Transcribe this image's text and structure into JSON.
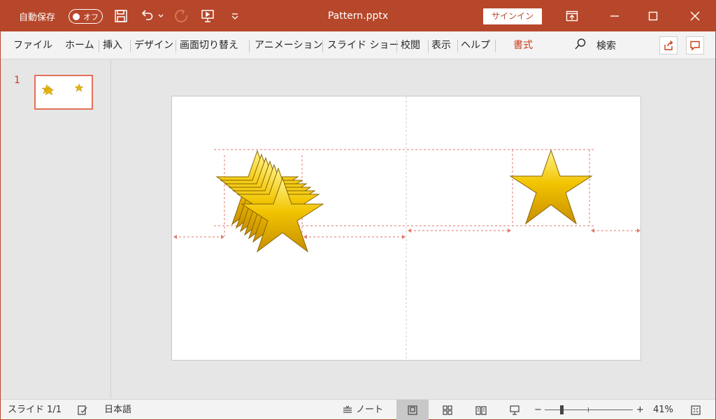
{
  "titlebar": {
    "autosave_label": "自動保存",
    "autosave_state": "オフ",
    "document_title": "Pattern.pptx",
    "signin_label": "サインイン",
    "accent_color": "#b7472a"
  },
  "ribbon": {
    "tabs": [
      {
        "label": "ファイル"
      },
      {
        "label": "ホーム"
      },
      {
        "label": "挿入"
      },
      {
        "label": "デザイン"
      },
      {
        "label": "画面切り替え"
      },
      {
        "label": "アニメーション"
      },
      {
        "label": "スライド ショー"
      },
      {
        "label": "校閲"
      },
      {
        "label": "表示"
      },
      {
        "label": "ヘルプ"
      },
      {
        "label": "書式"
      }
    ],
    "search_label": "検索",
    "active_contextual_color": "#c43e1c"
  },
  "thumbnails": {
    "items": [
      {
        "number": "1"
      }
    ]
  },
  "statusbar": {
    "slide_indicator": "スライド 1/1",
    "language": "日本語",
    "notes_label": "ノート",
    "zoom_minus": "−",
    "zoom_plus": "+",
    "zoom_level": "41%"
  },
  "icons": {
    "save": "save-icon",
    "undo": "undo-icon",
    "redo": "redo-icon",
    "present": "present-icon",
    "customize": "customize-toolbar-icon",
    "ribbon_display": "ribbon-display-icon",
    "minimize": "minimize-icon",
    "maximize": "maximize-icon",
    "close": "close-icon",
    "search": "search-icon",
    "share": "share-icon",
    "comments": "comment-icon",
    "accessibility": "accessibility-check-icon",
    "notes": "notes-icon",
    "view_normal": "normal-view-icon",
    "view_sorter": "slide-sorter-icon",
    "view_reading": "reading-view-icon",
    "view_slideshow": "slideshow-view-icon",
    "fit": "fit-to-window-icon"
  }
}
